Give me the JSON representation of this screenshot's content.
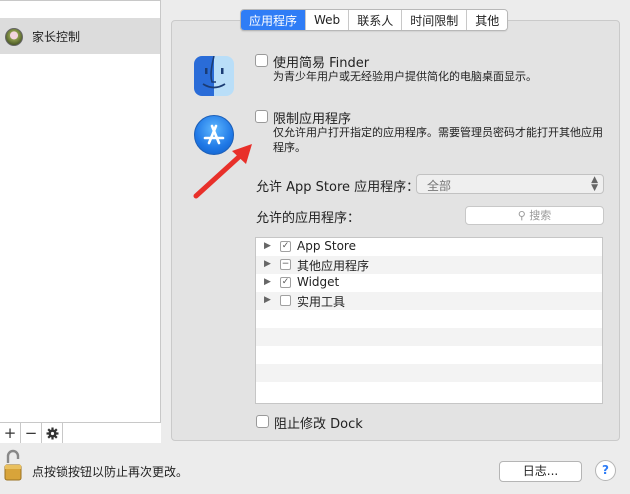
{
  "sidebar": {
    "user_label": "家长控制",
    "toolbar": {
      "add": "+",
      "remove": "−"
    }
  },
  "tabs": [
    {
      "label": "应用程序",
      "active": true
    },
    {
      "label": "Web",
      "active": false
    },
    {
      "label": "联系人",
      "active": false
    },
    {
      "label": "时间限制",
      "active": false
    },
    {
      "label": "其他",
      "active": false
    }
  ],
  "finder_option": {
    "label": "使用简易 Finder",
    "description": "为青少年用户或无经验用户提供简化的电脑桌面显示。",
    "checked": false
  },
  "restrict_option": {
    "label": "限制应用程序",
    "description": "仅允许用户打开指定的应用程序。需要管理员密码才能打开其他应用程序。",
    "checked": false
  },
  "app_store": {
    "label": "允许 App Store 应用程序：",
    "value": "全部"
  },
  "allowed_apps": {
    "label": "允许的应用程序：",
    "search_placeholder": "搜索",
    "items": [
      {
        "label": "App Store",
        "state": "✓"
      },
      {
        "label": "其他应用程序",
        "state": "−"
      },
      {
        "label": "Widget",
        "state": "✓"
      },
      {
        "label": "实用工具",
        "state": ""
      }
    ]
  },
  "dock_option": {
    "label": "阻止修改 Dock",
    "checked": false
  },
  "footer": {
    "lock_text": "点按锁按钮以防止再次更改。",
    "log_button": "日志...",
    "help_button": "?"
  },
  "colors": {
    "accent": "#2f7df6",
    "arrow": "#e8302a"
  }
}
